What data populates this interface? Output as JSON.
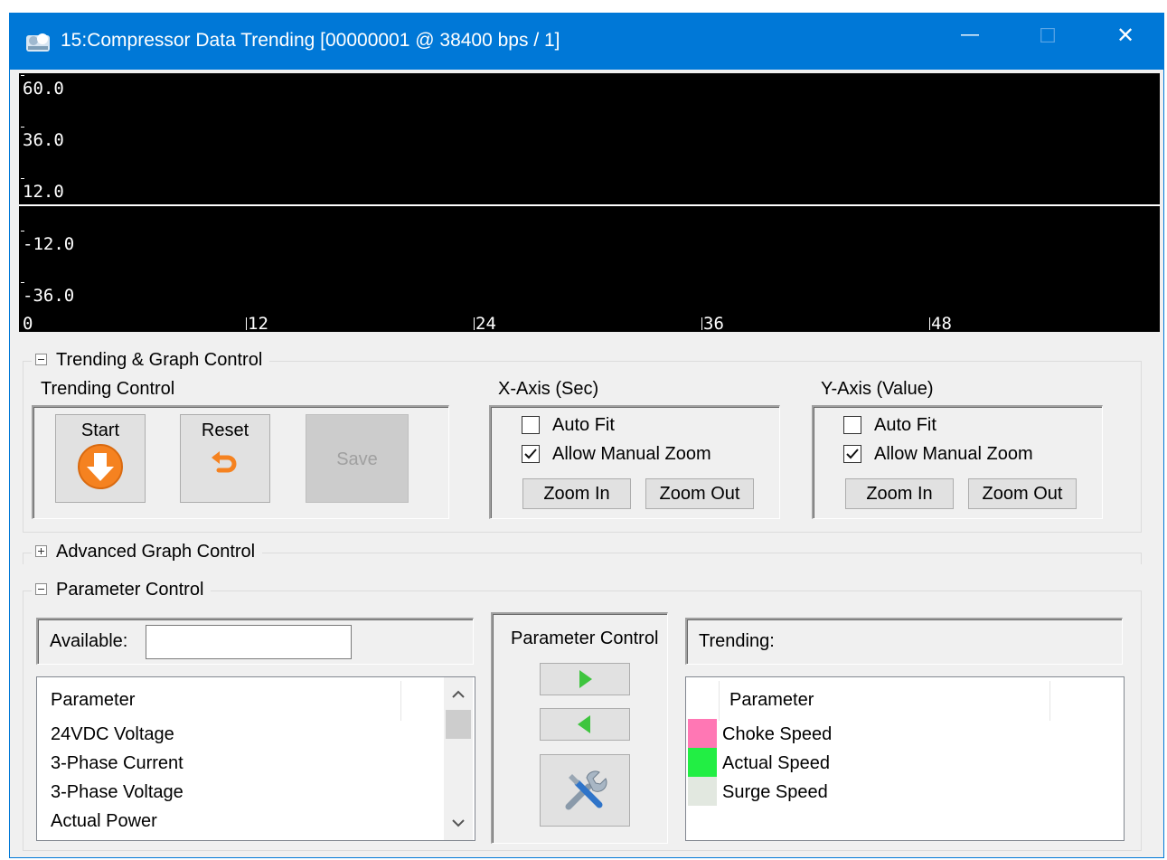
{
  "window": {
    "title": "15:Compressor Data Trending [00000001 @ 38400 bps / 1]",
    "minimize_glyph": "—",
    "maximize_glyph": "☐",
    "close_glyph": "✕"
  },
  "graph": {
    "y_labels": [
      "60.0",
      "36.0",
      "12.0",
      "-12.0",
      "-36.0"
    ],
    "x_labels": [
      "0",
      "12",
      "24",
      "36",
      "48"
    ]
  },
  "trending_graph_control": {
    "title": "Trending & Graph Control",
    "trending_control": {
      "label": "Trending Control",
      "start_label": "Start",
      "reset_label": "Reset",
      "save_label": "Save"
    },
    "x_axis": {
      "label": "X-Axis (Sec)",
      "auto_fit_label": "Auto Fit",
      "auto_fit_checked": false,
      "allow_manual_zoom_label": "Allow Manual Zoom",
      "allow_manual_zoom_checked": true,
      "zoom_in_label": "Zoom In",
      "zoom_out_label": "Zoom Out"
    },
    "y_axis": {
      "label": "Y-Axis (Value)",
      "auto_fit_label": "Auto Fit",
      "auto_fit_checked": false,
      "allow_manual_zoom_label": "Allow Manual Zoom",
      "allow_manual_zoom_checked": true,
      "zoom_in_label": "Zoom In",
      "zoom_out_label": "Zoom Out"
    }
  },
  "advanced_graph_control": {
    "title": "Advanced Graph Control"
  },
  "parameter_control": {
    "title": "Parameter Control",
    "available_label": "Available:",
    "available_value": "",
    "available_header": "Parameter",
    "available_items": [
      "24VDC Voltage",
      "3-Phase Current",
      "3-Phase Voltage",
      "Actual Power"
    ],
    "center_label": "Parameter Control",
    "trending_label": "Trending:",
    "trending_header": "Parameter",
    "trending_items": [
      {
        "name": "Choke Speed",
        "color": "#ff77b4"
      },
      {
        "name": "Actual Speed",
        "color": "#22ee44"
      },
      {
        "name": "Surge Speed",
        "color": "#e2e8e0"
      }
    ]
  }
}
